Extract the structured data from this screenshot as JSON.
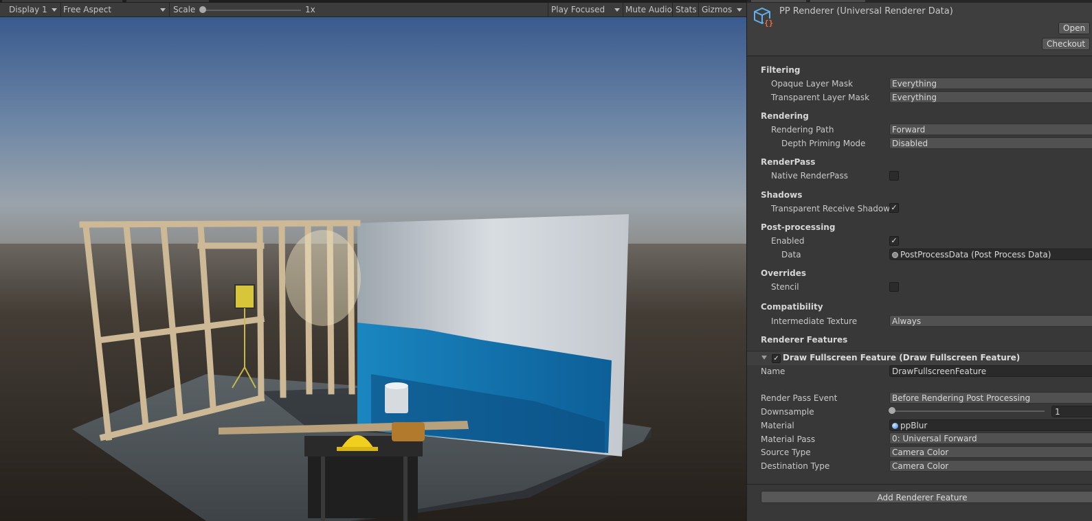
{
  "game_toolbar": {
    "display": "Display 1",
    "aspect": "Free Aspect",
    "scale_label": "Scale",
    "scale_value": "1x",
    "scale_level": 0.0,
    "play_mode": "Play Focused",
    "mute_audio": "Mute Audio",
    "stats": "Stats",
    "gizmos": "Gizmos"
  },
  "inspector": {
    "title": "PP Renderer (Universal Renderer Data)",
    "open_button": "Open",
    "checkout_button": "Checkout",
    "sections": {
      "filtering": "Filtering",
      "rendering": "Rendering",
      "renderpass": "RenderPass",
      "shadows": "Shadows",
      "postprocessing": "Post-processing",
      "overrides": "Overrides",
      "compatibility": "Compatibility",
      "renderer_features": "Renderer Features"
    },
    "fields": {
      "opaque_layer_mask": {
        "label": "Opaque Layer Mask",
        "value": "Everything"
      },
      "transparent_layer_mask": {
        "label": "Transparent Layer Mask",
        "value": "Everything"
      },
      "rendering_path": {
        "label": "Rendering Path",
        "value": "Forward"
      },
      "depth_priming_mode": {
        "label": "Depth Priming Mode",
        "value": "Disabled"
      },
      "native_renderpass": {
        "label": "Native RenderPass",
        "checked": false
      },
      "transparent_receive_shadows": {
        "label": "Transparent Receive Shadows",
        "checked": true
      },
      "pp_enabled": {
        "label": "Enabled",
        "checked": true
      },
      "pp_data": {
        "label": "Data",
        "value": "PostProcessData (Post Process Data)"
      },
      "stencil": {
        "label": "Stencil",
        "checked": false
      },
      "intermediate_texture": {
        "label": "Intermediate Texture",
        "value": "Always"
      }
    },
    "feature": {
      "title": "Draw Fullscreen Feature (Draw Fullscreen Feature)",
      "enabled": true,
      "name": {
        "label": "Name",
        "value": "DrawFullscreenFeature"
      },
      "render_pass_event": {
        "label": "Render Pass Event",
        "value": "Before Rendering Post Processing"
      },
      "downsample": {
        "label": "Downsample",
        "value": "1",
        "level": 0.0
      },
      "material": {
        "label": "Material",
        "value": "ppBlur"
      },
      "material_pass": {
        "label": "Material Pass",
        "value": "0: Universal Forward"
      },
      "source_type": {
        "label": "Source Type",
        "value": "Camera Color"
      },
      "destination_type": {
        "label": "Destination Type",
        "value": "Camera Color"
      }
    },
    "add_feature_button": "Add Renderer Feature",
    "check_glyph": "✓"
  },
  "colors": {
    "sky_top": "#3d5d90",
    "horizon": "#8a8c8e",
    "ground": "#3d3832",
    "accent_icon": "#f26b3a",
    "icon_blue": "#5fb0e8"
  }
}
